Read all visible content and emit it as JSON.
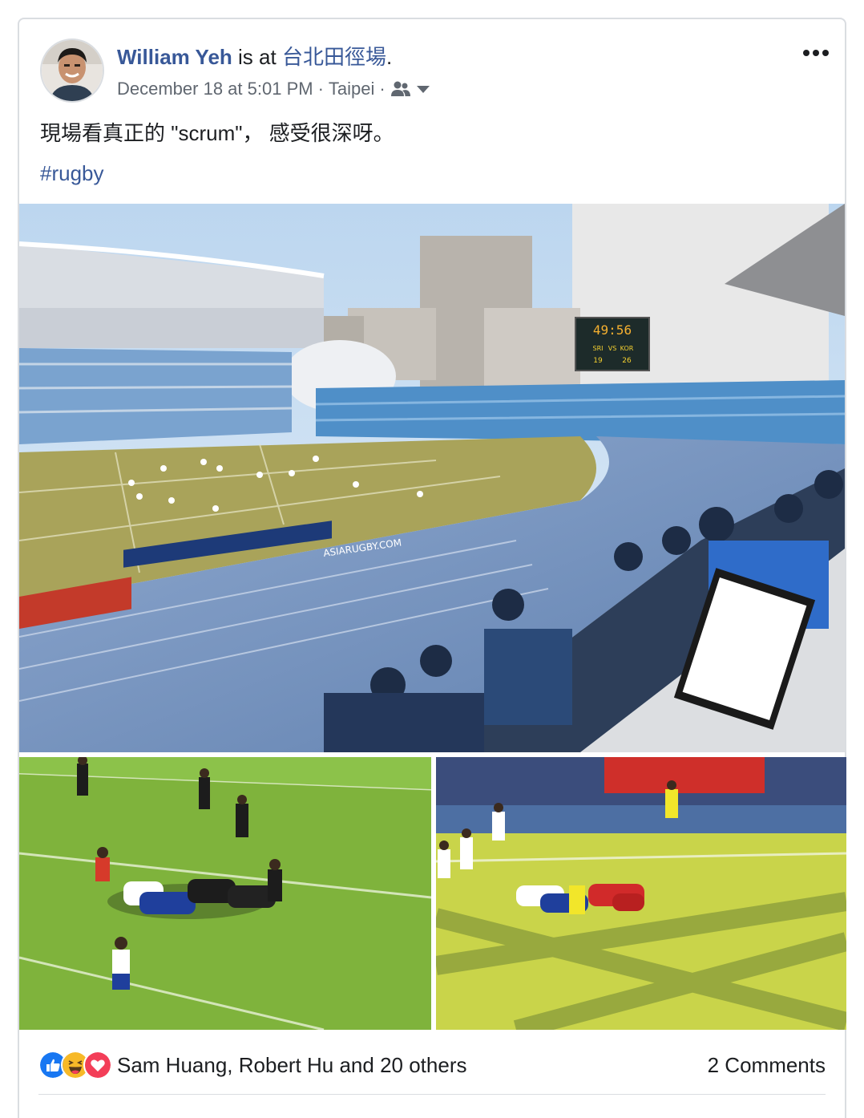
{
  "post": {
    "author": "William Yeh",
    "checkin_prefix": "is at",
    "place": "台北田徑場",
    "place_suffix": ".",
    "timestamp": "December 18 at 5:01 PM",
    "separator": "·",
    "location": "Taipei",
    "audience_icon": "friends-icon",
    "text": "現場看真正的 \"scrum\"， 感受很深呀。",
    "hashtag": "#rugby"
  },
  "photos": {
    "scoreboard_clock": "49:56",
    "scoreboard_home": "SRI",
    "scoreboard_vs": "VS",
    "scoreboard_away": "KOR",
    "scoreboard_home_score": "19",
    "scoreboard_away_score": "26",
    "banner_text": "ASIARUGBY.COM"
  },
  "footer": {
    "reaction_icons": [
      "like-icon",
      "haha-icon",
      "love-icon"
    ],
    "reactions_text": "Sam Huang, Robert Hu and 20 others",
    "comments_text": "2 Comments"
  },
  "colors": {
    "link": "#385898",
    "meta": "#606770",
    "like": "#1877f2",
    "haha": "#f7b928",
    "love": "#f33e58"
  }
}
